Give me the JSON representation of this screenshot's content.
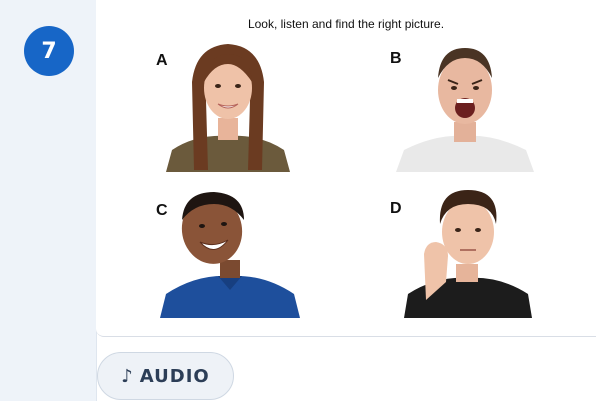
{
  "question": {
    "number": "7",
    "instruction": "Look, listen and find the right picture."
  },
  "options": [
    {
      "letter": "A",
      "photo": "smiling-young-woman-photo"
    },
    {
      "letter": "B",
      "photo": "angry-shouting-man-photo"
    },
    {
      "letter": "C",
      "photo": "laughing-boy-photo"
    },
    {
      "letter": "D",
      "photo": "bored-boy-photo"
    }
  ],
  "audio": {
    "icon": "music-note-icon",
    "label": "AUDIO"
  },
  "colors": {
    "badge": "#1766c7",
    "rail": "#eef3f9",
    "audio_bg": "#eef2f7",
    "audio_text": "#2c3e57"
  }
}
